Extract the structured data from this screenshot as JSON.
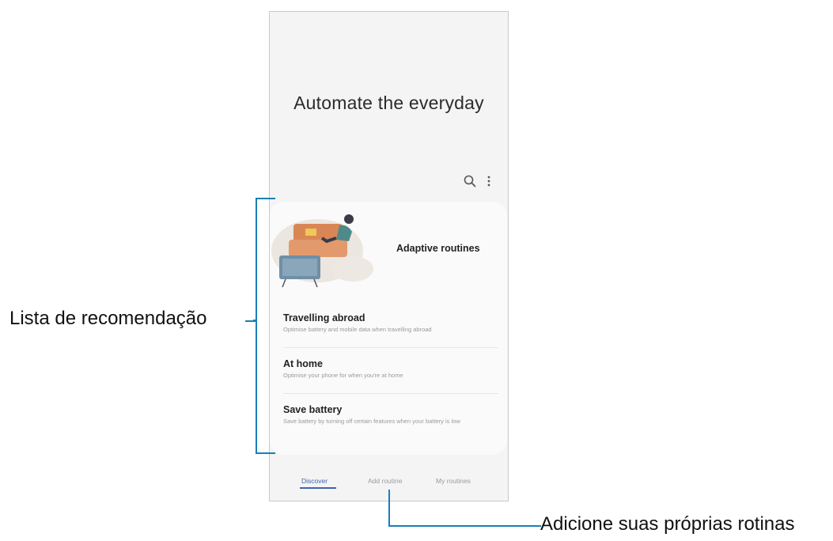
{
  "hero": {
    "title": "Automate the everyday"
  },
  "toolbar": {
    "search_icon": "search-icon",
    "more_icon": "more-vert-icon"
  },
  "card": {
    "header": "Adaptive routines",
    "items": [
      {
        "title": "Travelling abroad",
        "desc": "Optimise battery and mobile data when travelling abroad"
      },
      {
        "title": "At home",
        "desc": "Optimise your phone for when you're at home"
      },
      {
        "title": "Save battery",
        "desc": "Save battery by turning off certain features when your battery is low"
      }
    ]
  },
  "tabs": [
    {
      "label": "Discover",
      "active": true
    },
    {
      "label": "Add routine",
      "active": false
    },
    {
      "label": "My routines",
      "active": false
    }
  ],
  "annotations": {
    "recommendation_list": "Lista de recomendação",
    "add_own_routines": "Adicione suas próprias rotinas"
  },
  "colors": {
    "accent": "#3f62b0",
    "annotation_line": "#1a7fb5",
    "sofa": "#d98655",
    "tv": "#6f8fa6"
  }
}
